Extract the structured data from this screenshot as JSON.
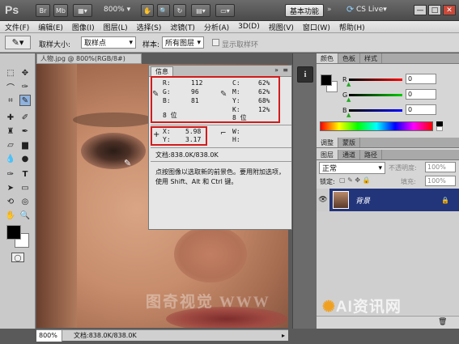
{
  "app": {
    "logo": "Ps",
    "zoom": "800%",
    "workspace_button": "基本功能",
    "cs_live": "CS Live▾",
    "tb_buttons": [
      "Br",
      "Mb",
      "▾",
      "▾"
    ],
    "win_buttons": [
      "—",
      "□",
      "✕"
    ]
  },
  "menu": [
    "文件(F)",
    "编辑(E)",
    "图像(I)",
    "图层(L)",
    "选择(S)",
    "滤镜(T)",
    "分析(A)",
    "3D(D)",
    "视图(V)",
    "窗口(W)",
    "帮助(H)"
  ],
  "options": {
    "sample_size_label": "取样大小:",
    "sample_size_value": "取样点",
    "sample_label": "样本:",
    "sample_value": "所有图层",
    "show_ring": "显示取样环"
  },
  "document": {
    "tab_title": "人物.jpg @ 800%(RGB/8#)",
    "zoom": "800%",
    "doc_size": "文档:838.0K/838.0K"
  },
  "info": {
    "tab": "信息",
    "rgb": [
      {
        "label": "R:",
        "value": "112"
      },
      {
        "label": "G:",
        "value": "96"
      },
      {
        "label": "B:",
        "value": "81"
      }
    ],
    "rgb_bits": "8 位",
    "cmyk": [
      {
        "label": "C:",
        "value": "62%"
      },
      {
        "label": "M:",
        "value": "62%"
      },
      {
        "label": "Y:",
        "value": "68%"
      },
      {
        "label": "K:",
        "value": "12%"
      }
    ],
    "cmyk_bits": "8 位",
    "xy": [
      {
        "label": "X:",
        "value": "5.98"
      },
      {
        "label": "Y:",
        "value": "3.17"
      }
    ],
    "wh": [
      {
        "label": "W:"
      },
      {
        "label": "H:"
      }
    ],
    "doc": "文档:838.0K/838.0K",
    "hint": "点按图像以选取新的前景色。要用附加选项，使用 Shift、Alt 和 Ctrl 键。"
  },
  "color_panel": {
    "tabs": [
      "颜色",
      "色板",
      "样式"
    ],
    "channels": [
      {
        "label": "R",
        "value": "0",
        "color": "#cc0000"
      },
      {
        "label": "G",
        "value": "0",
        "color": "#00aa00"
      },
      {
        "label": "B",
        "value": "0",
        "color": "#0000cc"
      }
    ]
  },
  "adjust_tabs": [
    "调整",
    "蒙版"
  ],
  "layers": {
    "tabs": [
      "图层",
      "通道",
      "路径"
    ],
    "blend_mode": "正常",
    "opacity_label": "不透明度:",
    "opacity_value": "100%",
    "lock_label": "锁定:",
    "fill_label": "填充:",
    "fill_value": "100%",
    "layer_name": "背景"
  },
  "watermark": {
    "left": "图奇视觉 WWW",
    "right": "AI资讯网"
  }
}
